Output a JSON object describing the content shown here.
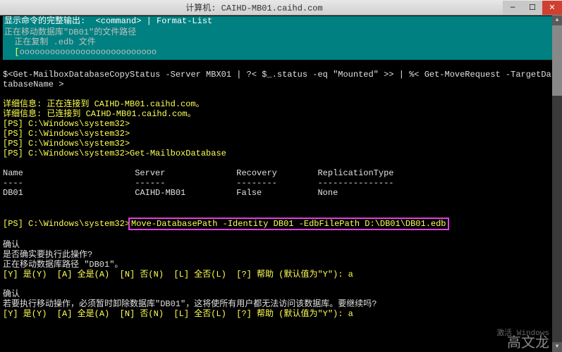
{
  "titlebar": {
    "title": "计算机: CAIHD-MB01.caihd.com"
  },
  "header_line": "显示命令的完整输出:  <command> | Format-List",
  "teal": {
    "line1": "正在移动数据库\"DB01\"的文件路径",
    "line2": "  正在复制 .edb 文件",
    "bracket_open": "  [",
    "progress": "ooooooooooooooooooooooooooo",
    "bracket_close": "                                                                                          ]"
  },
  "cmd_block": {
    "line1": "$<Get-MailboxDatabaseCopyStatus -Server MBX01 | ?< $_.status -eq \"Mounted\" >> | %< Get-MoveRequest -TargetDatabase $_.Da",
    "line2": "tabaseName >"
  },
  "detail": {
    "l1": "详细信息: 正在连接到 CAIHD-MB01.caihd.com。",
    "l2": "详细信息: 已连接到 CAIHD-MB01.caihd.com。"
  },
  "prompts": {
    "p1": "[PS] C:\\Windows\\system32>",
    "p2": "[PS] C:\\Windows\\system32>",
    "p3": "[PS] C:\\Windows\\system32>",
    "p4": "[PS] C:\\Windows\\system32>Get-MailboxDatabase",
    "p5": "[PS] C:\\Windows\\system32>"
  },
  "table": {
    "hdr": "Name                      Server              Recovery        ReplicationType",
    "div": "----                      ------              --------        ---------------",
    "row": "DB01                      CAIHD-MB01          False           None"
  },
  "highlighted_cmd": "Move-DatabasePath -Identity DB01 -EdbFilePath D:\\DB01\\DB01.edb",
  "confirm1": {
    "l1": "确认",
    "l2": "是否确实要执行此操作?",
    "l3": "正在移动数据库路径 \"DB01\"。",
    "l4": "[Y] 是(Y)  [A] 全是(A)  [N] 否(N)  [L] 全否(L)  [?] 帮助 (默认值为\"Y\"): a"
  },
  "confirm2": {
    "l1": "确认",
    "l2": "若要执行移动操作，必须暂时卸除数据库\"DB01\"，这将使所有用户都无法访问该数据库。要继续吗?",
    "l3": "[Y] 是(Y)  [A] 全是(A)  [N] 否(N)  [L] 全否(L)  [?] 帮助 (默认值为\"Y\"): a"
  },
  "watermark": {
    "l1": "激活 Windows",
    "l2": "高文龙"
  },
  "icons": {
    "min": "—",
    "max": "☐",
    "close": "✕",
    "up": "▲",
    "down": "▼"
  }
}
